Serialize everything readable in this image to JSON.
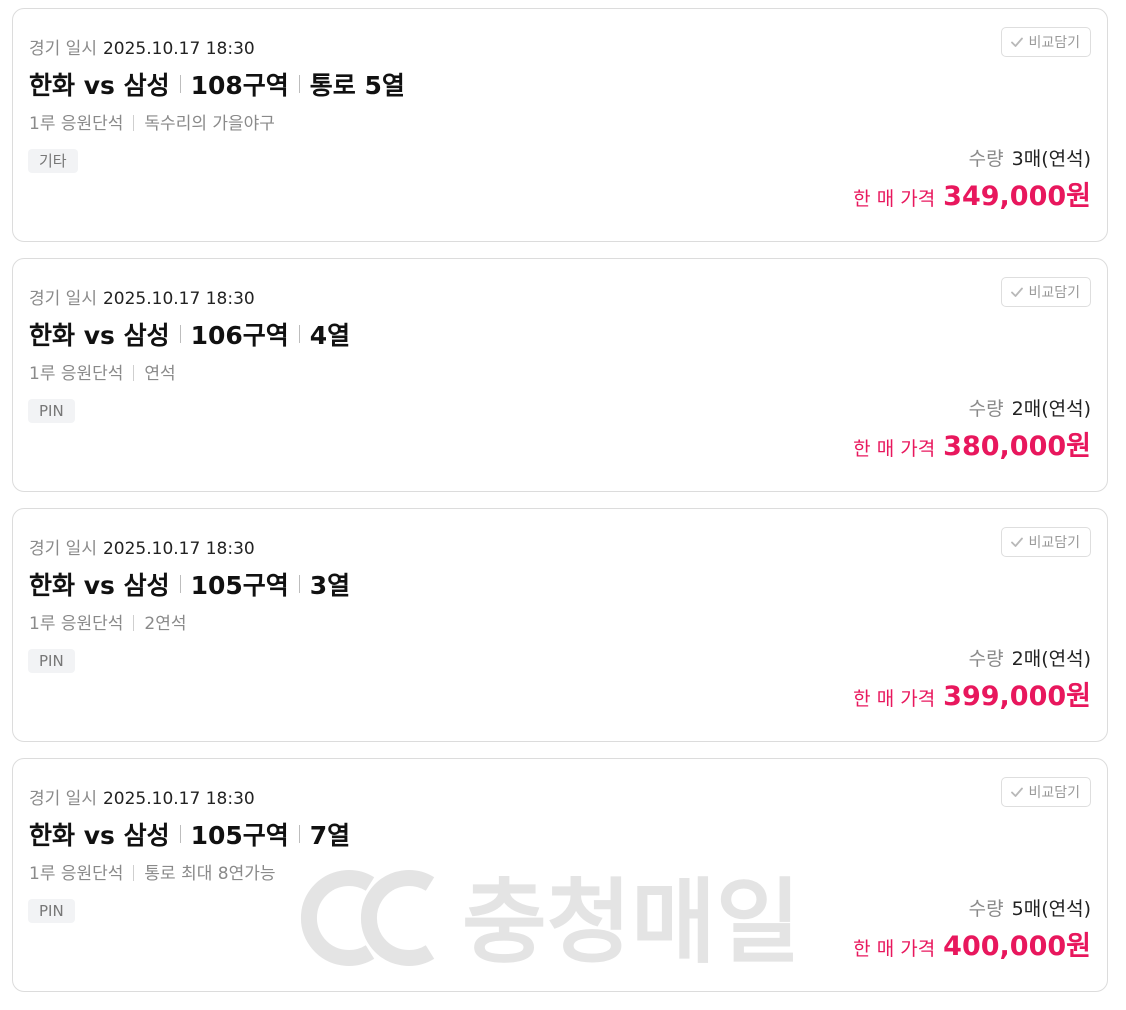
{
  "listings": [
    {
      "date_label": "경기 일시",
      "date": "2025.10.17 18:30",
      "match": "한화 vs 삼성",
      "section": "108구역",
      "row": "통로 5열",
      "area": "1루 응원단석",
      "note": "독수리의 가을야구",
      "tag": "기타",
      "compare_label": "비교담기",
      "qty_label": "수량",
      "qty": "3매(연석)",
      "price_label": "한 매 가격",
      "price": "349,000원"
    },
    {
      "date_label": "경기 일시",
      "date": "2025.10.17 18:30",
      "match": "한화 vs 삼성",
      "section": "106구역",
      "row": "4열",
      "area": "1루 응원단석",
      "note": "연석",
      "tag": "PIN",
      "compare_label": "비교담기",
      "qty_label": "수량",
      "qty": "2매(연석)",
      "price_label": "한 매 가격",
      "price": "380,000원"
    },
    {
      "date_label": "경기 일시",
      "date": "2025.10.17 18:30",
      "match": "한화 vs 삼성",
      "section": "105구역",
      "row": "3열",
      "area": "1루 응원단석",
      "note": "2연석",
      "tag": "PIN",
      "compare_label": "비교담기",
      "qty_label": "수량",
      "qty": "2매(연석)",
      "price_label": "한 매 가격",
      "price": "399,000원"
    },
    {
      "date_label": "경기 일시",
      "date": "2025.10.17 18:30",
      "match": "한화 vs 삼성",
      "section": "105구역",
      "row": "7열",
      "area": "1루 응원단석",
      "note": "통로 최대 8연가능",
      "tag": "PIN",
      "compare_label": "비교담기",
      "qty_label": "수량",
      "qty": "5매(연석)",
      "price_label": "한 매 가격",
      "price": "400,000원"
    }
  ],
  "watermark": {
    "text": "충청매일",
    "logo": "cc-logo-icon"
  },
  "colors": {
    "price": "#e8175d",
    "muted": "#8a8a8a",
    "border": "#dcdcdc",
    "tag_bg": "#f2f3f5"
  }
}
